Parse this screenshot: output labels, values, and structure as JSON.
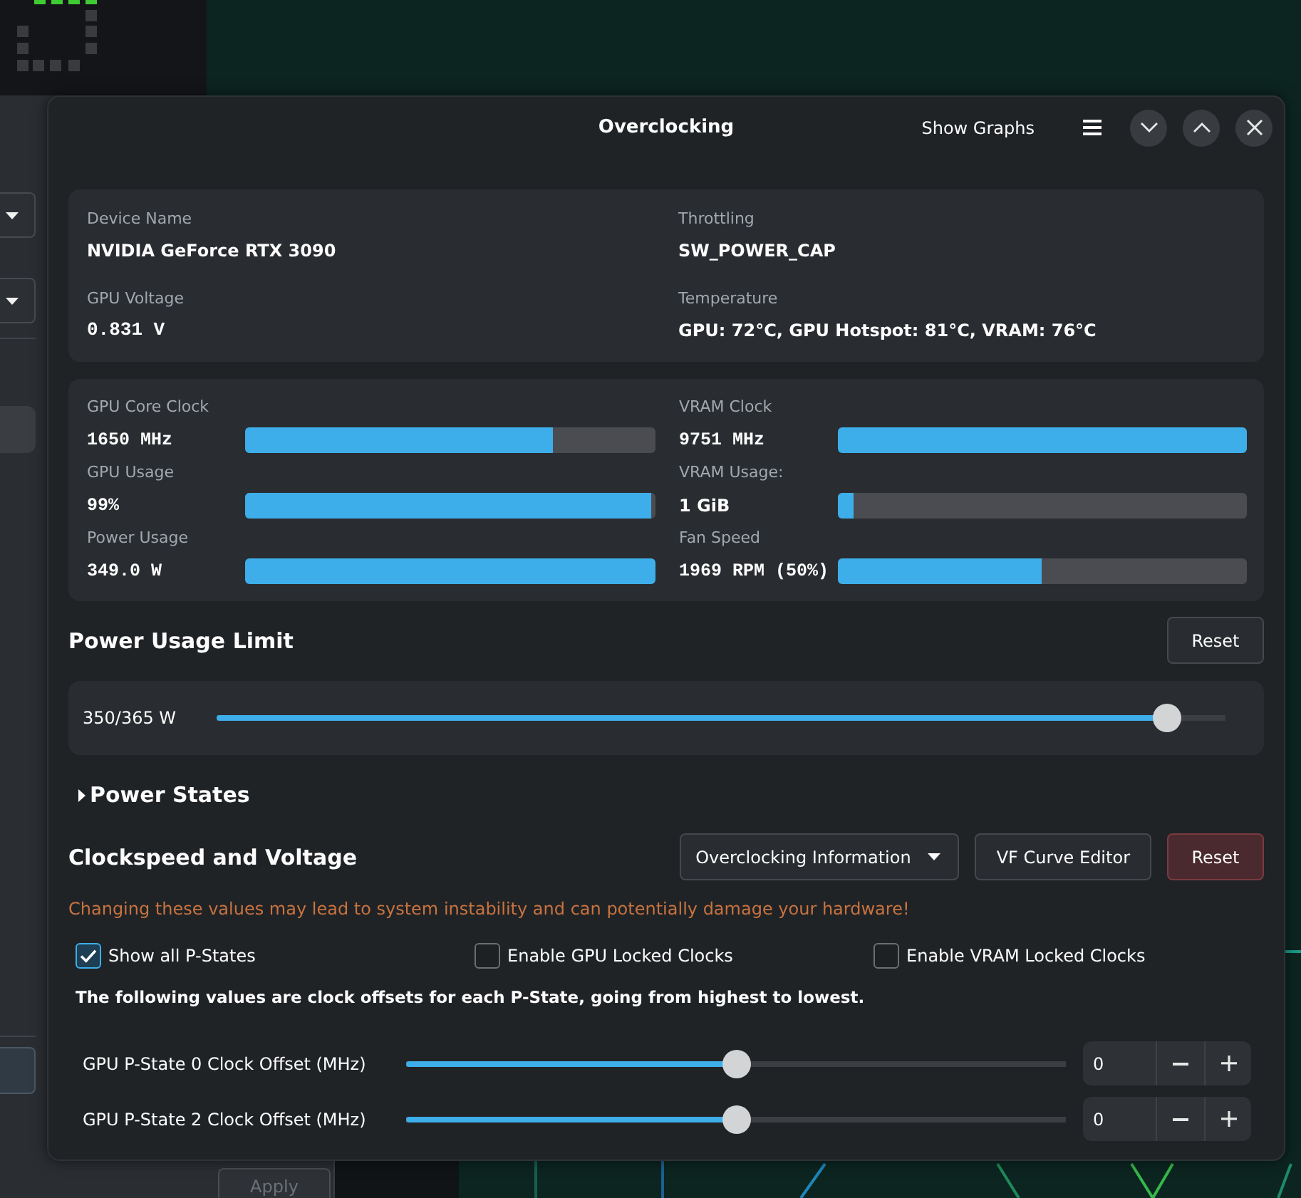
{
  "background_window": {
    "apply_button": {
      "label": "Apply",
      "disabled": true
    }
  },
  "window": {
    "title": "Overclocking",
    "show_graphs_button": "Show Graphs"
  },
  "device_info": [
    {
      "label": "Device Name",
      "value": "NVIDIA GeForce RTX 3090",
      "kind": "text"
    },
    {
      "label": "Throttling",
      "value": "SW_POWER_CAP",
      "kind": "text"
    },
    {
      "label": "GPU Voltage",
      "value": "0.831 V",
      "kind": "number"
    },
    {
      "label": "Temperature",
      "value": "GPU: 72°C, GPU Hotspot: 81°C, VRAM: 76°C",
      "kind": "text"
    }
  ],
  "stats": [
    {
      "label": "GPU Core Clock",
      "value": "1650 MHz",
      "kind": "number",
      "level": 0.75
    },
    {
      "label": "VRAM Clock",
      "value": "9751 MHz",
      "kind": "number",
      "level": 1.0
    },
    {
      "label": "GPU Usage",
      "value": "99%",
      "kind": "number",
      "level": 0.99
    },
    {
      "label": "VRAM Usage:",
      "value": "1 GiB",
      "kind": "text",
      "level": 0.04
    },
    {
      "label": "Power Usage",
      "value": "349.0 W",
      "kind": "number",
      "level": 1.0
    },
    {
      "label": "Fan Speed",
      "value": "1969 RPM (50%)",
      "kind": "number",
      "level": 0.5
    }
  ],
  "power_limit": {
    "title": "Power Usage Limit",
    "reset_button": "Reset",
    "reading": "350/365 W",
    "level": 0.955
  },
  "power_states": {
    "title": "Power States",
    "expanded": false
  },
  "clocks": {
    "title": "Clockspeed and Voltage",
    "dropdown": "Overclocking Information",
    "buttons": [
      {
        "label": "VF Curve Editor",
        "kind": "normal"
      },
      {
        "label": "Reset",
        "kind": "danger"
      }
    ],
    "warning": "Changing these values may lead to system instability and can potentially damage your hardware!",
    "options": [
      {
        "label": "Show all P-States",
        "checked": true
      },
      {
        "label": "Enable GPU Locked Clocks",
        "checked": false
      },
      {
        "label": "Enable VRAM Locked Clocks",
        "checked": false
      }
    ],
    "note": "The following values are clock offsets for each P-State, going from highest to lowest.",
    "offsets": [
      {
        "label": "GPU P-State 0 Clock Offset (MHz)",
        "level": 0.5,
        "value": "0"
      },
      {
        "label": "GPU P-State 2 Clock Offset (MHz)",
        "level": 0.5,
        "value": "0"
      }
    ]
  }
}
